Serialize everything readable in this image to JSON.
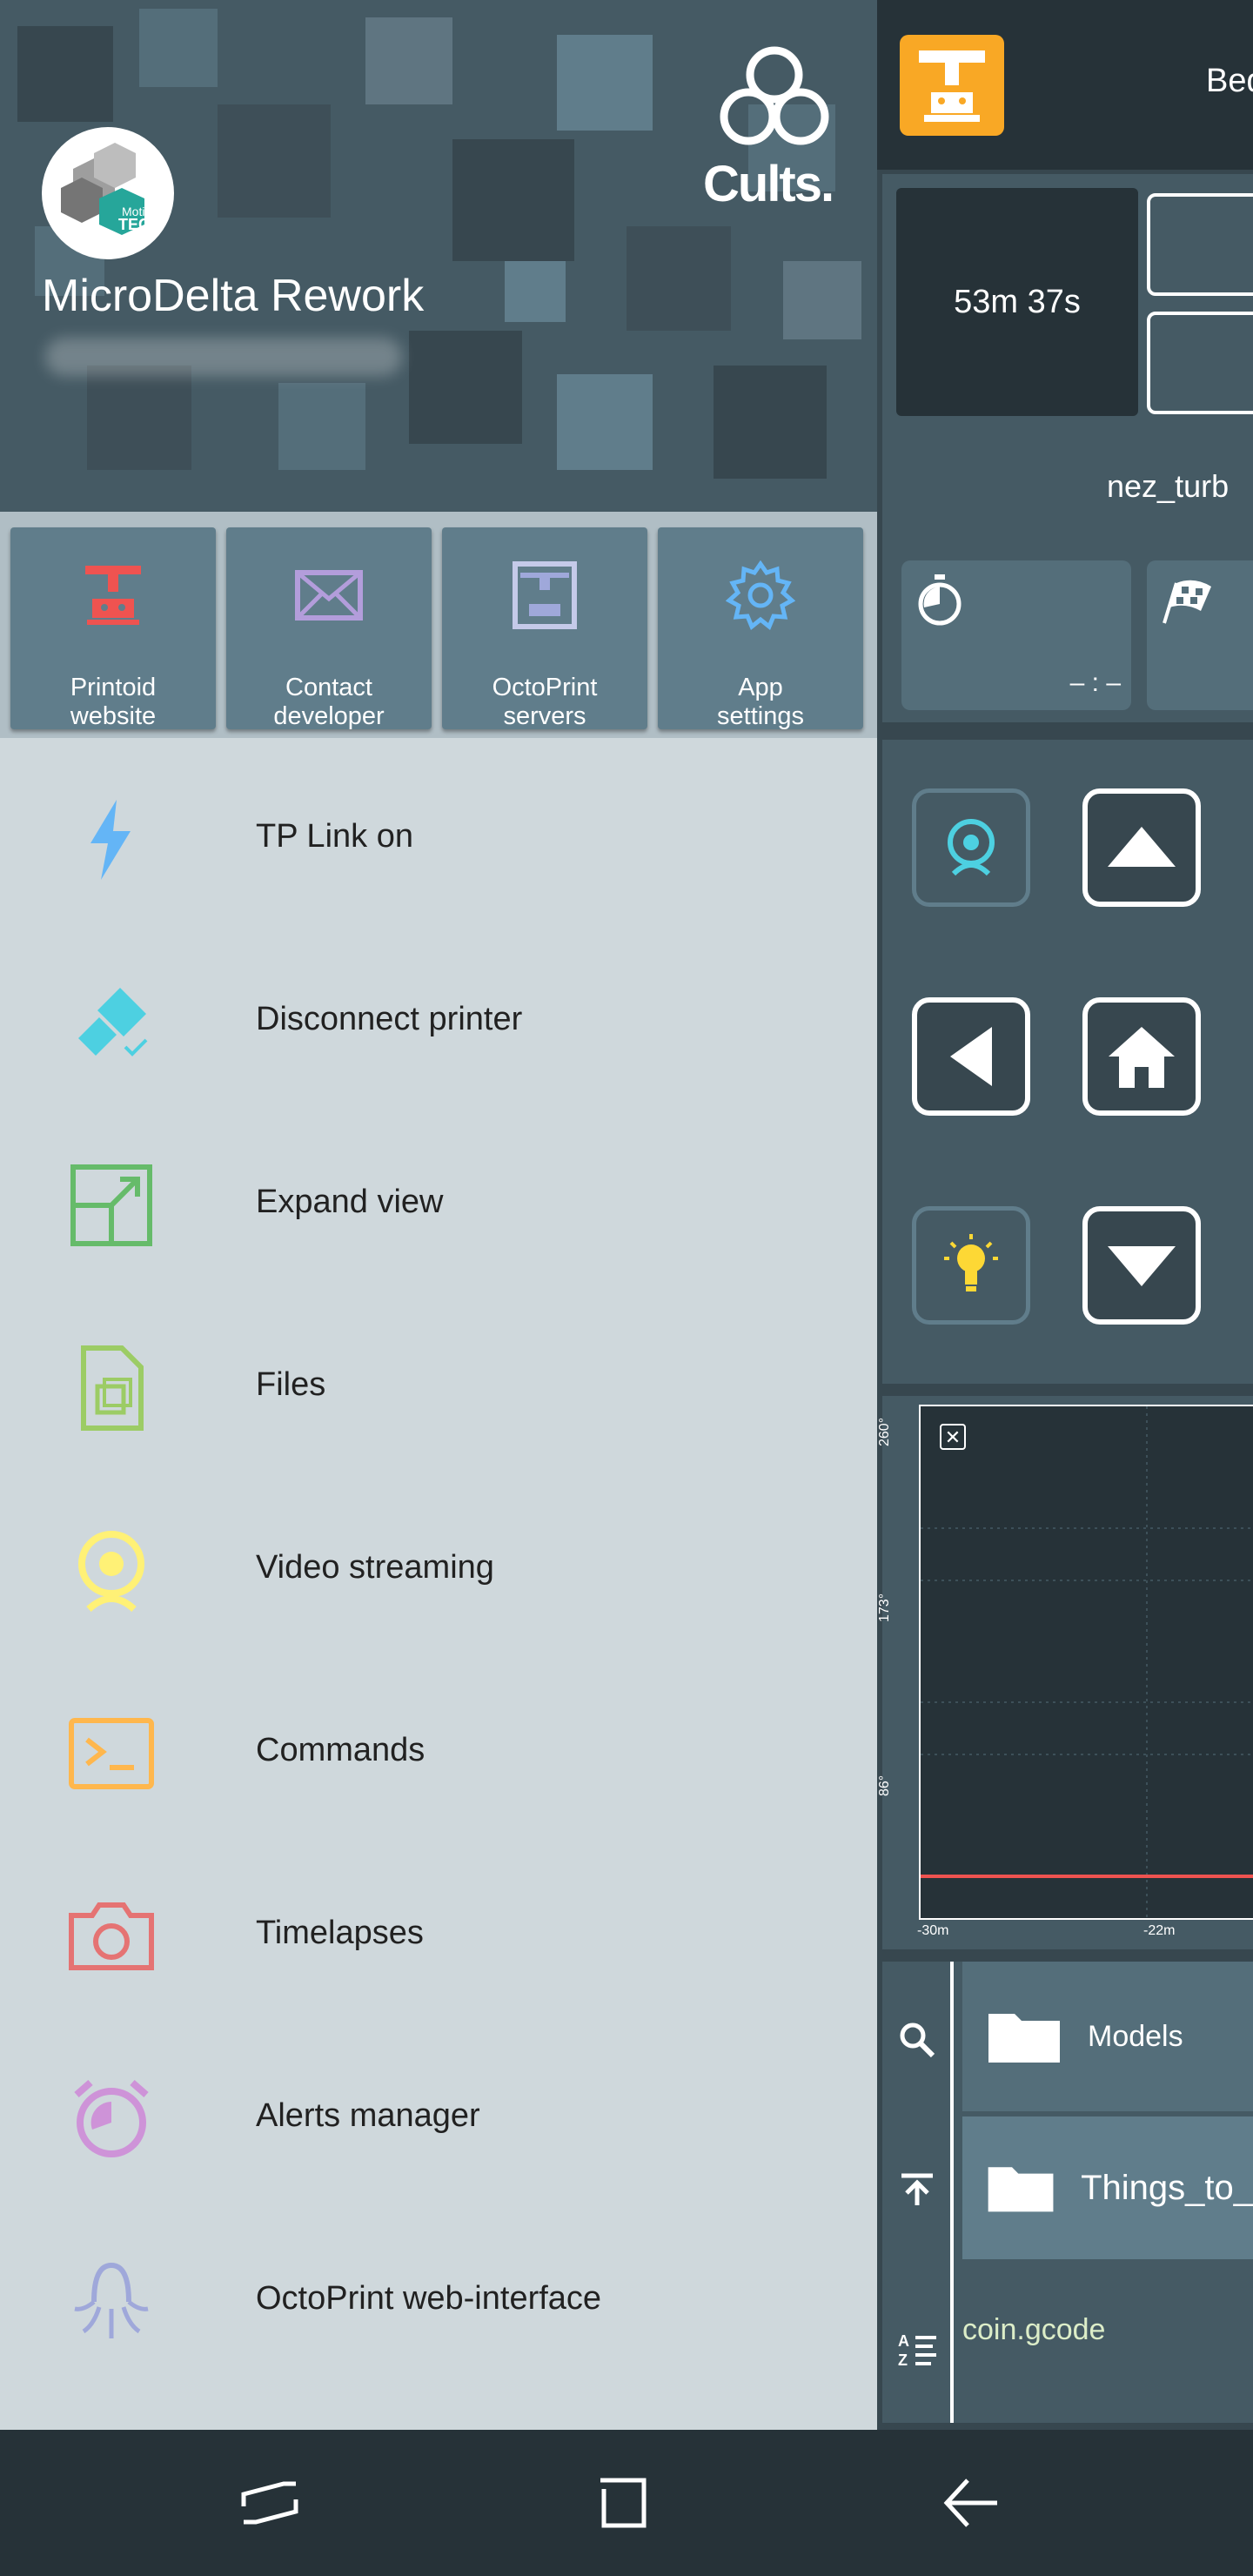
{
  "app": {
    "title_partial": "Bed",
    "print_time": "53m 37s",
    "job_name_partial": "nez_turb",
    "eta_value": "– : –",
    "chart": {
      "y_ticks": [
        "260°",
        "173°",
        "86°"
      ],
      "x_ticks": [
        "-30m",
        "-22m"
      ],
      "close_glyph": "✕"
    },
    "files": {
      "folders": [
        "Models",
        "Things_to_"
      ],
      "file": "coin.gcode"
    }
  },
  "drawer": {
    "profile_name": "MicroDelta Rework",
    "brand": "Cults.",
    "quick_actions": [
      {
        "label": "Printoid\nwebsite",
        "icon": "printoid-icon",
        "color": "#ef5350"
      },
      {
        "label": "Contact\ndeveloper",
        "icon": "mail-icon",
        "color": "#b39ddb"
      },
      {
        "label": "OctoPrint\nservers",
        "icon": "printer-frame-icon",
        "color": "#9fa8da"
      },
      {
        "label": "App\nsettings",
        "icon": "gear-icon",
        "color": "#64b5f6"
      }
    ],
    "menu": [
      {
        "label": "TP Link on",
        "icon": "lightning-icon",
        "color": "#64b5f6"
      },
      {
        "label": "Disconnect printer",
        "icon": "plug-disconnect-icon",
        "color": "#4dd0e1"
      },
      {
        "label": "Expand view",
        "icon": "expand-icon",
        "color": "#66bb6a"
      },
      {
        "label": "Files",
        "icon": "file-icon",
        "color": "#9ccc65"
      },
      {
        "label": "Video streaming",
        "icon": "webcam-icon",
        "color": "#fff176"
      },
      {
        "label": "Commands",
        "icon": "terminal-icon",
        "color": "#ffb74d"
      },
      {
        "label": "Timelapses",
        "icon": "camera-icon",
        "color": "#e57373"
      },
      {
        "label": "Alerts manager",
        "icon": "alarm-clock-icon",
        "color": "#ce93d8"
      },
      {
        "label": "OctoPrint web-interface",
        "icon": "octopus-icon",
        "color": "#9fa8da"
      }
    ]
  }
}
